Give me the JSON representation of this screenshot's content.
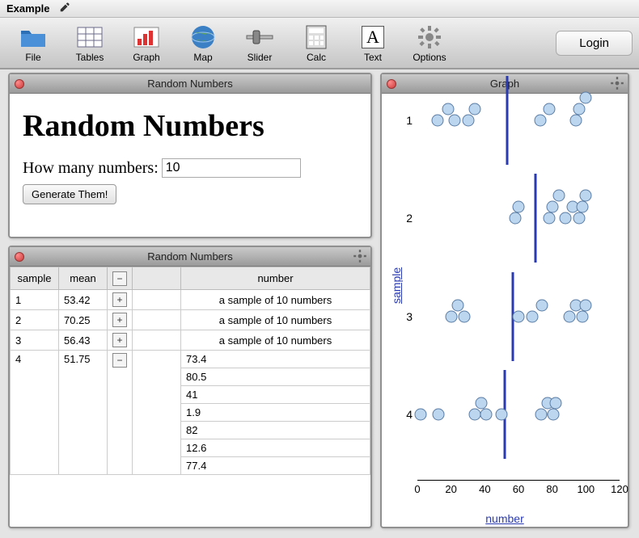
{
  "app_title": "Example",
  "toolbar": {
    "items": [
      {
        "id": "file",
        "label": "File"
      },
      {
        "id": "tables",
        "label": "Tables"
      },
      {
        "id": "graph",
        "label": "Graph"
      },
      {
        "id": "map",
        "label": "Map"
      },
      {
        "id": "slider",
        "label": "Slider"
      },
      {
        "id": "calc",
        "label": "Calc"
      },
      {
        "id": "text",
        "label": "Text"
      },
      {
        "id": "options",
        "label": "Options"
      }
    ],
    "login_label": "Login"
  },
  "panels": {
    "generator": {
      "title": "Random Numbers",
      "heading": "Random Numbers",
      "prompt": "How many numbers:",
      "input_value": "10",
      "button_label": "Generate Them!"
    },
    "table": {
      "title": "Random Numbers",
      "columns": [
        "sample",
        "mean",
        "",
        "",
        "number"
      ],
      "rows": [
        {
          "sample": "1",
          "mean": "53.42",
          "expanded": false,
          "summary": "a sample of 10 numbers"
        },
        {
          "sample": "2",
          "mean": "70.25",
          "expanded": false,
          "summary": "a sample of 10 numbers"
        },
        {
          "sample": "3",
          "mean": "56.43",
          "expanded": false,
          "summary": "a sample of 10 numbers"
        },
        {
          "sample": "4",
          "mean": "51.75",
          "expanded": true,
          "numbers": [
            "73.4",
            "80.5",
            "41",
            "1.9",
            "82",
            "12.6",
            "77.4"
          ]
        }
      ]
    },
    "graph": {
      "title": "Graph",
      "ylabel": "sample",
      "xlabel": "number",
      "xlim": [
        0,
        120
      ],
      "yticks": [
        1,
        2,
        3,
        4
      ],
      "xticks": [
        0,
        20,
        40,
        60,
        80,
        100,
        120
      ]
    }
  },
  "chart_data": {
    "type": "scatter",
    "title": "Graph",
    "xlabel": "number",
    "ylabel": "sample",
    "xlim": [
      0,
      120
    ],
    "y_categories": [
      1,
      2,
      3,
      4
    ],
    "series": [
      {
        "name": "sample 1",
        "y": 1,
        "mean": 53.42,
        "values": [
          12,
          18,
          22,
          30,
          34,
          73,
          78,
          94,
          96,
          100
        ]
      },
      {
        "name": "sample 2",
        "y": 2,
        "mean": 70.25,
        "values": [
          58,
          60,
          78,
          80,
          84,
          88,
          92,
          96,
          98,
          100
        ]
      },
      {
        "name": "sample 3",
        "y": 3,
        "mean": 56.43,
        "values": [
          20,
          24,
          28,
          60,
          68,
          74,
          90,
          94,
          98,
          100
        ]
      },
      {
        "name": "sample 4",
        "y": 4,
        "mean": 51.75,
        "values": [
          1.9,
          12.6,
          34,
          38,
          41,
          50,
          73.4,
          77.4,
          80.5,
          82
        ]
      }
    ]
  }
}
